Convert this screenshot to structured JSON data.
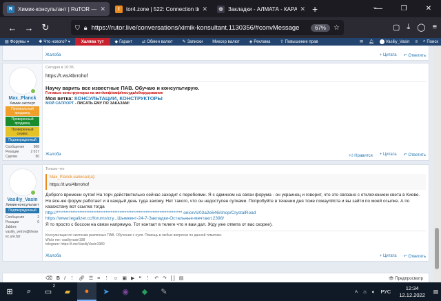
{
  "browser": {
    "tabs": [
      {
        "title": "Химик-консультант | RuTOR — гла",
        "active": true
      },
      {
        "title": "tor4.zone | 522: Connection tim",
        "active": false
      },
      {
        "title": "Закладки - АЛМАТА - КАРАГА",
        "active": false
      }
    ],
    "new_tab": "+",
    "url": "https://rutor.live/conversations/ximik-konsultant.1130356/#convMessage",
    "zoom": "67%"
  },
  "site_menu": {
    "items": [
      "Форумы",
      "Что нового?",
      "Халява тут",
      "Гарант",
      "Обмен валют",
      "Записки",
      "Миксер валют",
      "Реклама",
      "Повышение прав"
    ],
    "user": "Vasiliy_Vasin",
    "search": "Поиск"
  },
  "top_post": {
    "complaint": "Жалоба",
    "quote": "Цитата",
    "reply": "Ответить"
  },
  "post1": {
    "author": "Max_Planck",
    "user_title": "Химик-эксперт",
    "badges": [
      {
        "label": "Премиальный продавец",
        "color": "#f0a02a"
      },
      {
        "label": "Проверенный продавец",
        "color": "#1a8c2e"
      },
      {
        "label": "Проверенный сервис",
        "color": "#e6c229"
      },
      {
        "label": "Подтвержденный",
        "color": "#2577b1"
      }
    ],
    "stats": [
      {
        "k": "Сообщения",
        "v": "988"
      },
      {
        "k": "Реакции",
        "v": "2 017"
      },
      {
        "k": "Сделки",
        "v": "50"
      }
    ],
    "date": "Сегодня в 10:35",
    "link": "https://t.ws/4brrohof",
    "sig_head": "Научу варить все известные ПАВ. Обучаю и консультирую.",
    "sig_red": "Готовые конструкторы на мет/меф/амф/посуда/оборудование",
    "sig_branch_label": "Моя ветка: ",
    "sig_branch_link": "КОНСУЛЬТАЦИИ, КОНСТРУКТОРЫ",
    "sig_support_link": "МОЙ САППОРТ",
    "sig_support_text": " - ПИСАТЬ ЕМУ ПО ЗАКАЗАМ!",
    "complaint": "Жалоба",
    "like": "Нравится",
    "quote": "Цитата",
    "reply": "Ответить"
  },
  "post2": {
    "author": "Vasiliy_Vasin",
    "user_title": "Химик-консультант",
    "badges": [
      {
        "label": "Подтвержденный",
        "color": "#2577b1"
      }
    ],
    "stats": [
      {
        "k": "Сообщения",
        "v": "2"
      },
      {
        "k": "Реакции",
        "v": "0"
      },
      {
        "k": "Jabber:",
        "v": ""
      }
    ],
    "jabber": "vasiliy_vetrov@theseec.ure.biz",
    "date": "Только что",
    "quote_head": "Max_Planck написал(а):",
    "quote_text": "https://t.ws/4brrohof",
    "text_p1": "Доброго времени суток! На торч действительно сейчас заходит с перебоями. Я с админом на связи форума - он украинец и говорит, что это связано с отключением света в Киеве. Но все-же форум работает и я каждый день туда захожу. Нет такого, что он недоступен сутками. Попробуйте в течении дня тоже пожаулйста и вы зайти по моей ссылке. А по казахстану вот ссылка тогда",
    "text_link1": "http://************************************************************************.onion/s/03a2e646/shop/CrystalRoad",
    "text_link2": "https://www.legalizer.cc/forums/сгу...Шымкент-24-7-Закладки-Остальные-мечтают.2398/",
    "text_p2": "Я то просто с боссом на связи напрямую. Тот контакт в телеге что я вам дал. Жду уже ответа от вас скорее).",
    "sig1": "Консультации по синтезам различных ПАВ. Обучение с нуля. Помощь в любых вопросах по данной тематике.",
    "sig2": "Wickr me: vasiliyvasin198",
    "sig3": "telegram: https://t.me/VasiliyVasin1980",
    "complaint": "Жалоба",
    "quote": "Цитата",
    "reply": "Ответить"
  },
  "editor": {
    "preview": "Предпросмотр"
  },
  "taskbar": {
    "time": "12:34",
    "date": "12.12.2022",
    "lang": "РУС",
    "badge_count": "2"
  }
}
